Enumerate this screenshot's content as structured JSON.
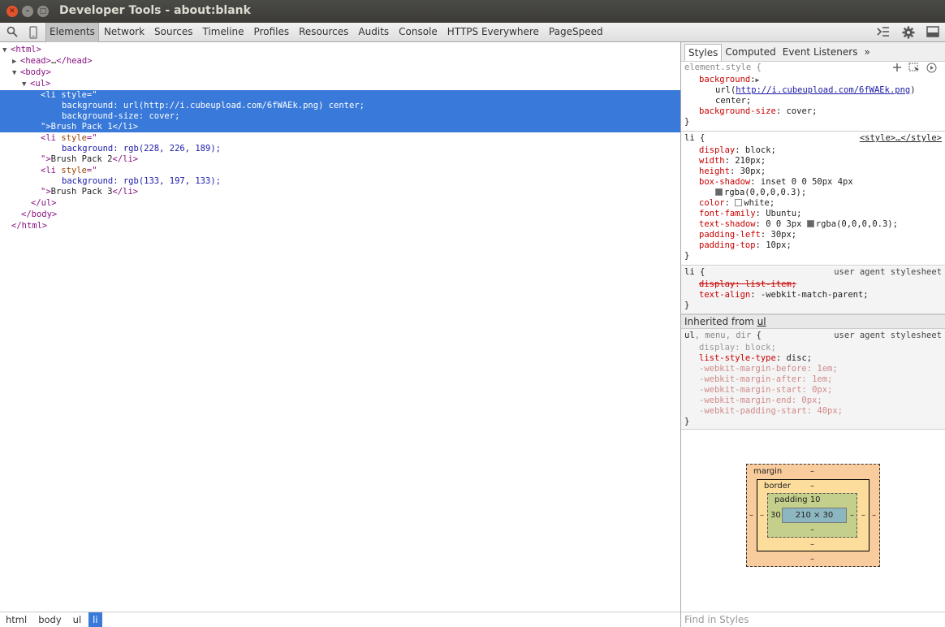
{
  "window": {
    "title": "Developer Tools - about:blank"
  },
  "toolbar": {
    "tabs": [
      "Elements",
      "Network",
      "Sources",
      "Timeline",
      "Profiles",
      "Resources",
      "Audits",
      "Console",
      "HTTPS Everywhere",
      "PageSpeed"
    ]
  },
  "dom": {
    "l1": "<html>",
    "l2a": "<head>",
    "l2b": "…",
    "l2c": "</head>",
    "l3": "<body>",
    "l4": "<ul>",
    "li1_open": "<li ",
    "li1_attr": "style",
    "li1_eq": "=\"",
    "li1_s1": "background: url(http://i.cubeupload.com/6fWAEk.png) center;",
    "li1_s2": "background-size: cover;",
    "li1_close_a": "\">",
    "li1_text": "Brush Pack 1",
    "li1_close_b": "</li>",
    "li2_open": "<li ",
    "li2_attr": "style",
    "li2_eq": "=\"",
    "li2_s1": "background: rgb(228, 226, 189);",
    "li2_close_a": "\">",
    "li2_text": "Brush Pack 2",
    "li2_close_b": "</li>",
    "li3_open": "<li ",
    "li3_attr": "style",
    "li3_eq": "=\"",
    "li3_s1": "background: rgb(133, 197, 133);",
    "li3_close_a": "\">",
    "li3_text": "Brush Pack 3",
    "li3_close_b": "</li>",
    "l_ul_end": "</ul>",
    "l_body_end": "</body>",
    "l_html_end": "</html>"
  },
  "breadcrumbs": [
    "html",
    "body",
    "ul",
    "li"
  ],
  "sidebar": {
    "tabs": [
      "Styles",
      "Computed",
      "Event Listeners"
    ],
    "more": "»",
    "element_style": {
      "selector": "element.style {",
      "bg_prop": "background",
      "bg_url_pre": "url(",
      "bg_url": "http://i.cubeupload.com/6fWAEk.png",
      "bg_url_post": ")",
      "bg_center": "center;",
      "bgsize_prop": "background-size",
      "bgsize_val": "cover;",
      "close": "}"
    },
    "li_rule": {
      "selector": "li {",
      "source": "<style>…</style>",
      "props": [
        {
          "p": "display",
          "v": "block;"
        },
        {
          "p": "width",
          "v": "210px;"
        },
        {
          "p": "height",
          "v": "30px;"
        },
        {
          "p": "box-shadow",
          "v": "inset 0 0 50px 4px"
        },
        {
          "p": "",
          "v": "rgba(0,0,0,0.3);"
        },
        {
          "p": "color",
          "v": "white;"
        },
        {
          "p": "font-family",
          "v": "Ubuntu;"
        },
        {
          "p": "text-shadow",
          "v": "0 0 3px ",
          "v2": "rgba(0,0,0,0.3);"
        },
        {
          "p": "padding-left",
          "v": "30px;"
        },
        {
          "p": "padding-top",
          "v": "10px;"
        }
      ],
      "close": "}"
    },
    "li_ua": {
      "selector": "li {",
      "source": "user agent stylesheet",
      "p1": "display: list-item;",
      "p2_prop": "text-align",
      "p2_val": "-webkit-match-parent;",
      "close": "}"
    },
    "inherited_label": "Inherited from ",
    "inherited_link": "ul",
    "ul_ua": {
      "selector_a": "ul",
      "selector_b": ", menu, dir",
      "selector_c": " {",
      "source": "user agent stylesheet",
      "display": "display: block;",
      "lst_prop": "list-style-type",
      "lst_val": "disc;",
      "faded": [
        "-webkit-margin-before: 1em;",
        "-webkit-margin-after: 1em;",
        "-webkit-margin-start: 0px;",
        "-webkit-margin-end: 0px;",
        "-webkit-padding-start: 40px;"
      ],
      "close": "}"
    },
    "box_model": {
      "margin_label": "margin",
      "border_label": "border",
      "padding_label": "padding 10",
      "content": "210 × 30",
      "dash": "–",
      "padding_left": "30"
    },
    "find_placeholder": "Find in Styles"
  },
  "colors": {
    "selection": "#3879d9",
    "accent_close": "#e2532c"
  }
}
